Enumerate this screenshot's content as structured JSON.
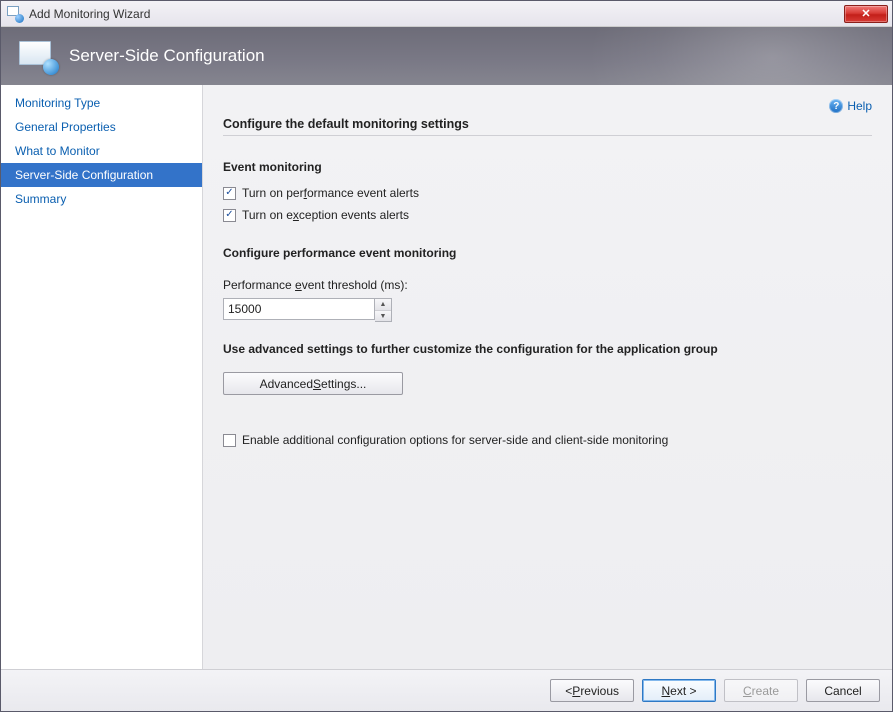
{
  "window": {
    "title": "Add Monitoring Wizard",
    "close_icon_label": "✕"
  },
  "banner": {
    "title": "Server-Side Configuration"
  },
  "sidebar": {
    "items": [
      {
        "label": "Monitoring Type",
        "active": false
      },
      {
        "label": "General Properties",
        "active": false
      },
      {
        "label": "What to Monitor",
        "active": false
      },
      {
        "label": "Server-Side Configuration",
        "active": true
      },
      {
        "label": "Summary",
        "active": false
      }
    ]
  },
  "help": {
    "label": "Help"
  },
  "main": {
    "section_title": "Configure the default monitoring settings",
    "event_monitoring": {
      "heading": "Event monitoring",
      "perf_alerts": {
        "label_pre": "Turn on per",
        "label_hot": "f",
        "label_post": "ormance event alerts",
        "checked": true
      },
      "exc_alerts": {
        "label_pre": "Turn on e",
        "label_hot": "x",
        "label_post": "ception events alerts",
        "checked": true
      }
    },
    "perf_config": {
      "heading": "Configure performance event monitoring",
      "threshold_label_pre": "Performance ",
      "threshold_label_hot": "e",
      "threshold_label_post": "vent threshold (ms):",
      "threshold_value": "15000"
    },
    "advanced": {
      "heading": "Use advanced settings to further customize the configuration for the application group",
      "button_pre": "Advanced ",
      "button_hot": "S",
      "button_post": "ettings..."
    },
    "additional": {
      "label": "Enable additional configuration options for server-side and client-side monitoring",
      "checked": false
    }
  },
  "footer": {
    "previous_pre": "< ",
    "previous_hot": "P",
    "previous_post": "revious",
    "next_hot": "N",
    "next_post": "ext >",
    "create_hot": "C",
    "create_post": "reate",
    "cancel": "Cancel"
  }
}
